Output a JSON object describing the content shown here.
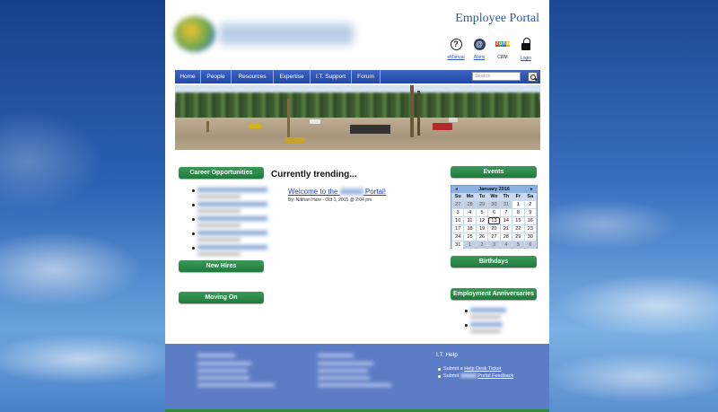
{
  "header": {
    "portal_title": "Employee Portal",
    "icons": [
      {
        "icon": "help-icon",
        "label": "eManual"
      },
      {
        "icon": "alar-icon",
        "label": "Alaris"
      },
      {
        "icon": "zoho-crm-icon",
        "label": "CRM"
      },
      {
        "icon": "lock-icon",
        "label": "Login"
      }
    ],
    "zoho_text": "zoho"
  },
  "nav": {
    "items": [
      "Home",
      "People",
      "Resources",
      "Expertise",
      "I.T. Support",
      "Forum"
    ],
    "search_placeholder": "Search"
  },
  "left_column": {
    "career_label": "Career Opportunities",
    "new_hires_label": "New Hires",
    "moving_on_label": "Moving On"
  },
  "main": {
    "trending_title": "Currently trending...",
    "post": {
      "title_prefix": "Welcome to the",
      "title_suffix": "Portal!",
      "meta": "By: Nathan Hare - Oct 1, 2015 @ 2:04 pm"
    }
  },
  "right_column": {
    "events_label": "Events",
    "birthdays_label": "Birthdays",
    "anniversaries_label": "Employment Anniversaries",
    "calendar": {
      "month": "January 2016",
      "prev": "◄",
      "next": "►",
      "days_of_week": [
        "Su",
        "Mo",
        "Tu",
        "We",
        "Th",
        "Fr",
        "Sa"
      ],
      "weeks": [
        [
          "27",
          "28",
          "29",
          "30",
          "31",
          "1",
          "2"
        ],
        [
          "3",
          "4",
          "5",
          "6",
          "7",
          "8",
          "9"
        ],
        [
          "10",
          "11",
          "12",
          "13",
          "14",
          "15",
          "16"
        ],
        [
          "17",
          "18",
          "19",
          "20",
          "21",
          "22",
          "23"
        ],
        [
          "24",
          "25",
          "26",
          "27",
          "28",
          "29",
          "30"
        ],
        [
          "31",
          "1",
          "2",
          "3",
          "4",
          "5",
          "6"
        ]
      ],
      "today": "13"
    }
  },
  "footer": {
    "it_help_title": "I.T. Help",
    "it_links": [
      {
        "prefix": "Submit a",
        "link": "Help Desk Ticket"
      },
      {
        "prefix": "Submit",
        "link": "Portal Feedback"
      }
    ]
  }
}
